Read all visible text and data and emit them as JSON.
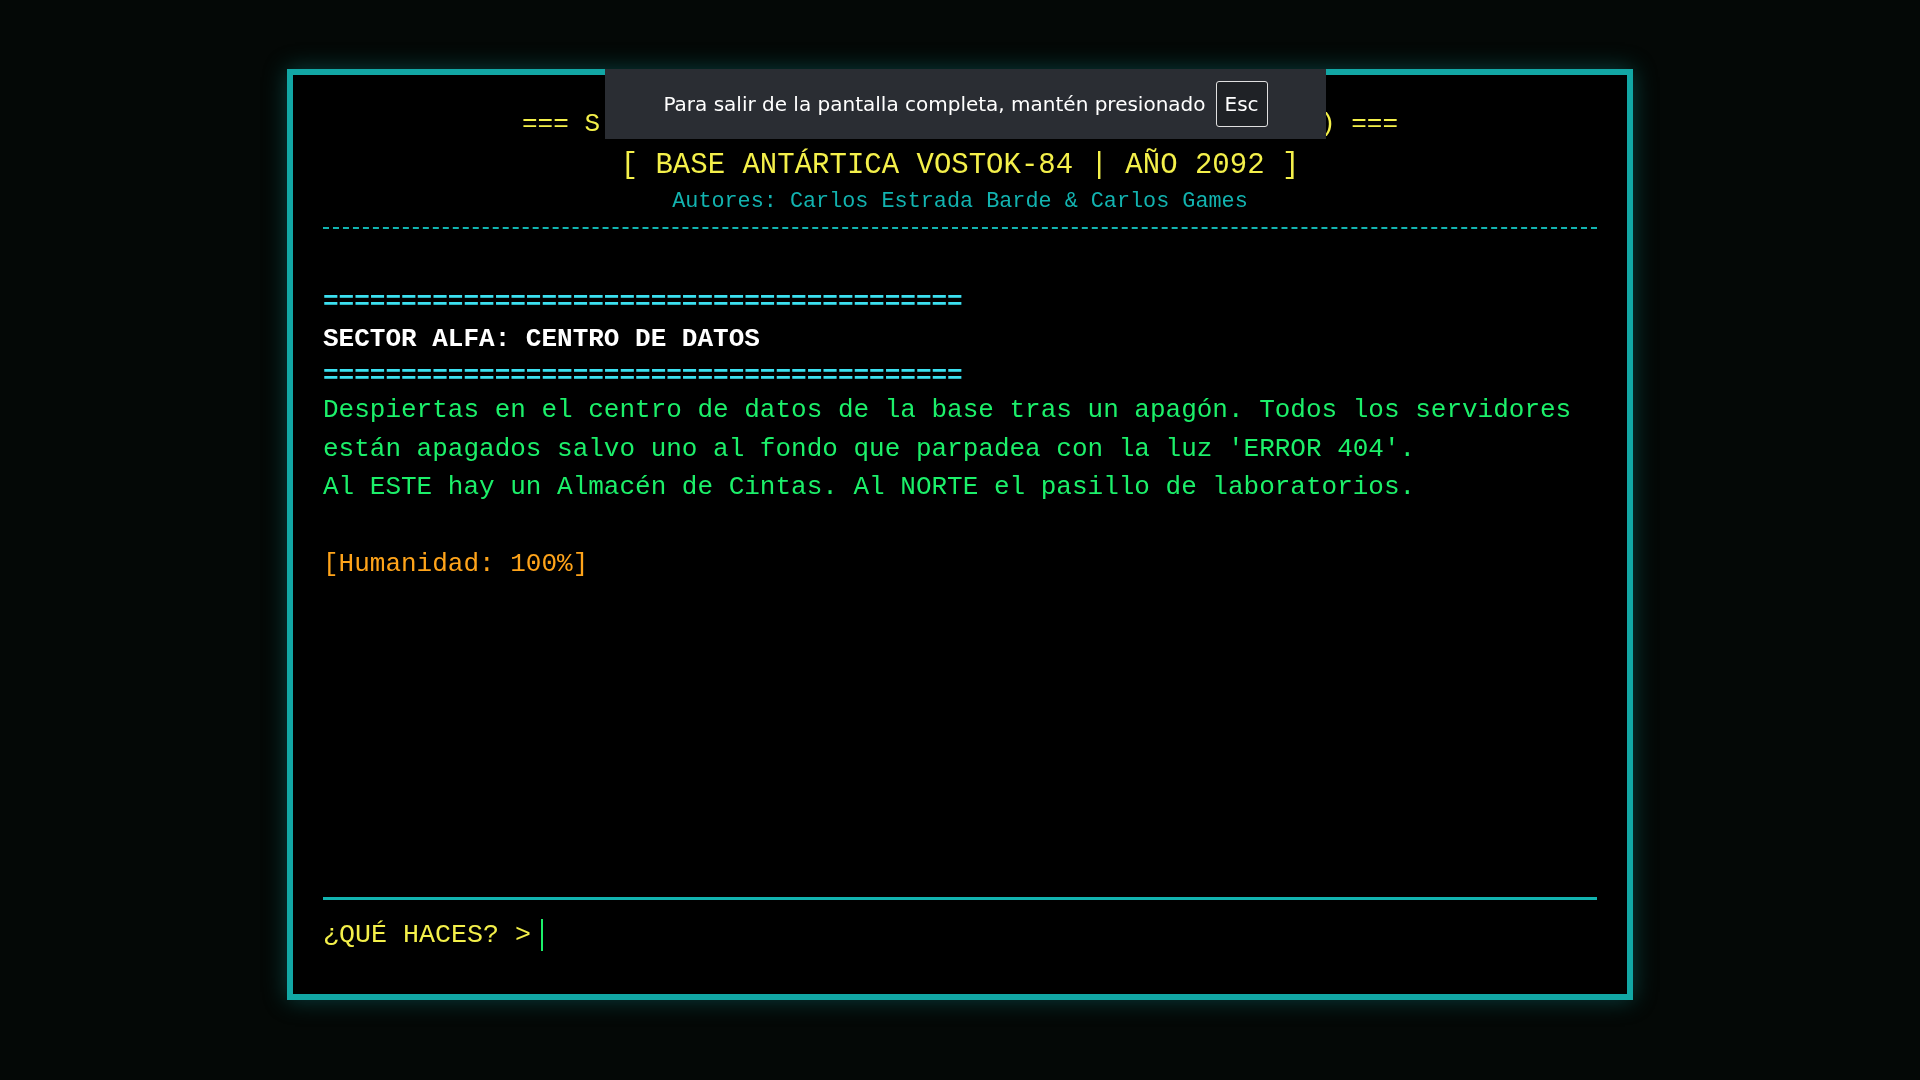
{
  "title": {
    "left": "=== S",
    "right": ") ==="
  },
  "subtitle": "[ BASE ANTÁRTICA VOSTOK-84 | AÑO 2092 ]",
  "authors": "Autores: Carlos Estrada Barde & Carlos Games",
  "room": {
    "rule_top": "=========================================",
    "name": "SECTOR ALFA: CENTRO DE DATOS",
    "rule_bottom": "=========================================",
    "paragraphs": [
      "Despiertas en el centro de datos de la base tras un apagón. Todos los servidores están apagados salvo uno al fondo que parpadea con la luz 'ERROR 404'.",
      "Al ESTE hay un Almacén de Cintas. Al NORTE el pasillo de laboratorios."
    ]
  },
  "status": "[Humanidad: 100%]",
  "prompt": "¿QUÉ HACES? >",
  "toast": {
    "message": "Para salir de la pantalla completa, mantén presionado",
    "key": "Esc"
  }
}
